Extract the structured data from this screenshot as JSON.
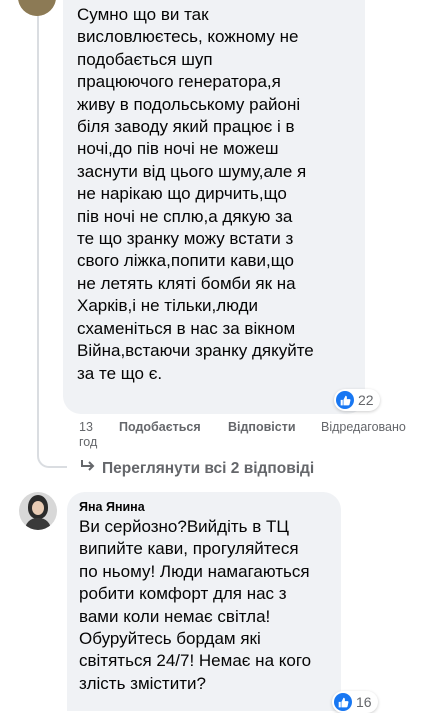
{
  "comment1": {
    "text": "Сумно що ви так\nвисловлюєтесь, кожному не\nподобається шуп\nпрацюючого генератора,я\nживу в подольському районі\nбіля заводу який працює і в\nночі,до пів ночі не можеш\nзаснути від цього шуму,але я\nне нарікаю що дирчить,що\nпів ночі не сплю,а дякую за\nте що зранку можу встати з\nсвого ліжка,попити кави,що\nне летять кляті бомби як на\nХарків,і не тільки,люди\nсхаменіться в нас за вікном\nВійна,встаючи зранку дякуйте\nза те що є.",
    "reaction_icon": "thumbs-up-icon",
    "reaction_count": "22",
    "time_line1": "13",
    "time_line2": "год",
    "like_label": "Подобається",
    "reply_label": "Відповісти",
    "edited_label": "Відредаговано"
  },
  "view_replies": {
    "icon": "reply-arrow-icon",
    "label": "Переглянути всі 2 відповіді"
  },
  "comment2": {
    "author": "Яна Янина",
    "text": "Ви серйозно?Вийдіть в ТЦ\nвипийте кави, прогуляйтеся\nпо ньому! Люди намагаються\nробити комфорт для нас з\nвами коли немає світла!\nОбуруйтесь бордам які\nсвітяться 24/7! Немає на кого\nзлість змістити?",
    "reaction_icon": "thumbs-up-icon",
    "reaction_count": "16"
  },
  "colors": {
    "bubble": "#f0f2f5",
    "meta_text": "#65676b",
    "like_blue": "#1877f2",
    "thread_line": "#dadde1"
  }
}
